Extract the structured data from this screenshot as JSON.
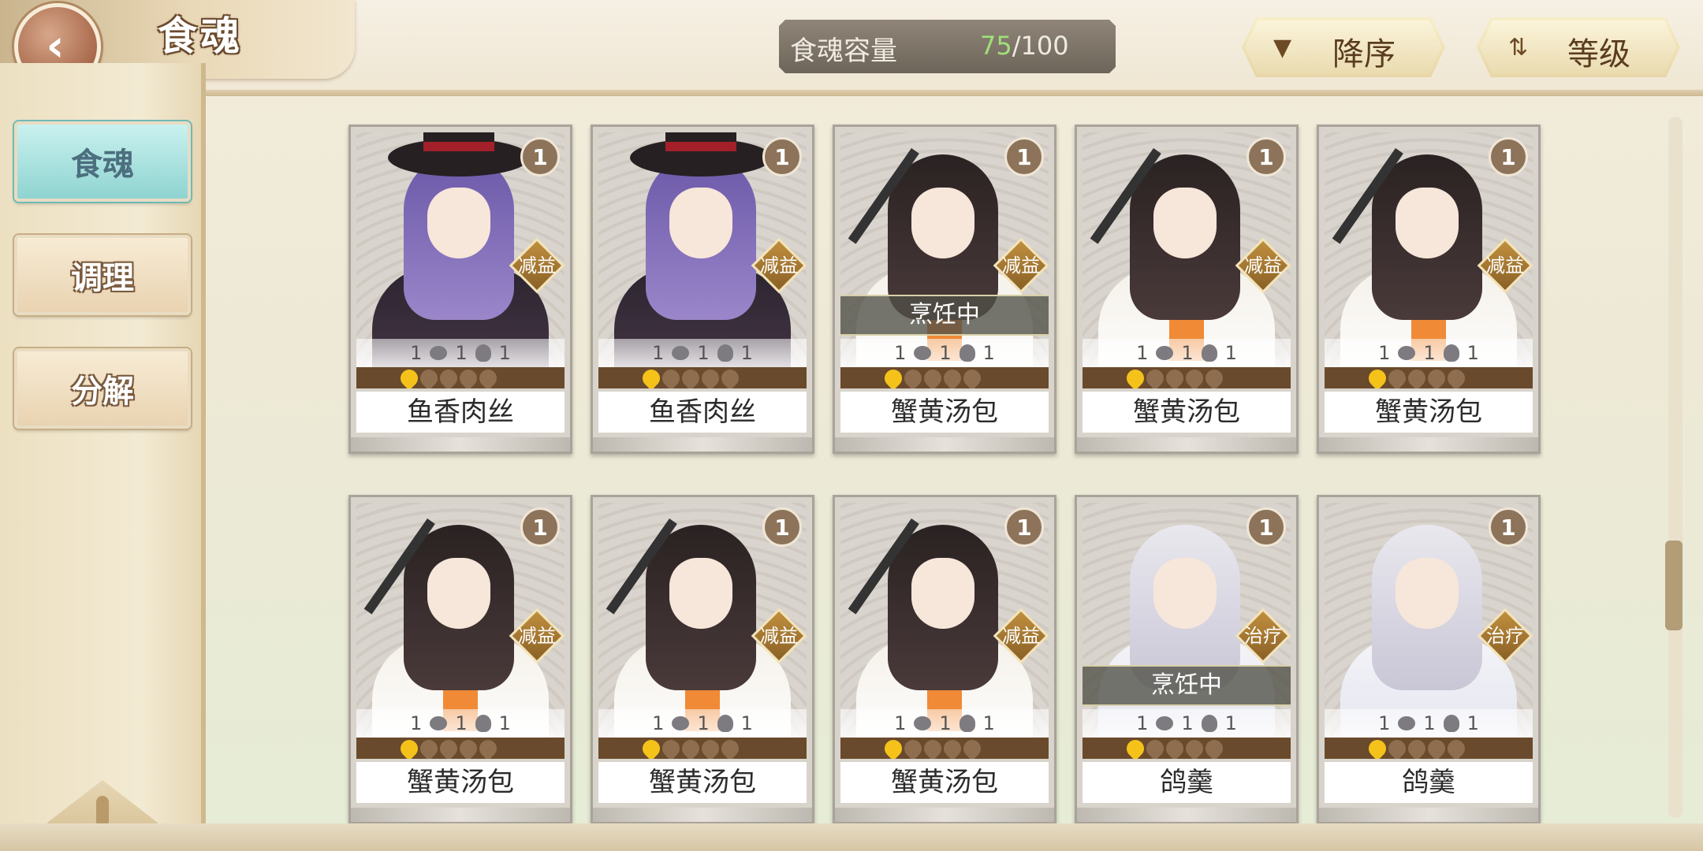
{
  "header": {
    "title": "食魂",
    "capacity": {
      "label": "食魂容量",
      "current": "75",
      "separator": "/",
      "max": "100"
    },
    "sort_order": {
      "label": "降序",
      "icon": "triangle-down-icon"
    },
    "sort_level": {
      "label": "等级",
      "icon": "sort-arrows-icon"
    }
  },
  "sidebar": {
    "items": [
      {
        "label": "食魂",
        "active": true
      },
      {
        "label": "调理",
        "active": false
      },
      {
        "label": "分解",
        "active": false
      }
    ]
  },
  "cards": [
    {
      "name": "鱼香肉丝",
      "level": "1",
      "role": "减益",
      "status": "",
      "stats": [
        "1",
        "1",
        "1"
      ],
      "stars": 1
    },
    {
      "name": "鱼香肉丝",
      "level": "1",
      "role": "减益",
      "status": "",
      "stats": [
        "1",
        "1",
        "1"
      ],
      "stars": 1
    },
    {
      "name": "蟹黄汤包",
      "level": "1",
      "role": "减益",
      "status": "烹饪中",
      "stats": [
        "1",
        "1",
        "1"
      ],
      "stars": 1
    },
    {
      "name": "蟹黄汤包",
      "level": "1",
      "role": "减益",
      "status": "",
      "stats": [
        "1",
        "1",
        "1"
      ],
      "stars": 1
    },
    {
      "name": "蟹黄汤包",
      "level": "1",
      "role": "减益",
      "status": "",
      "stats": [
        "1",
        "1",
        "1"
      ],
      "stars": 1
    },
    {
      "name": "蟹黄汤包",
      "level": "1",
      "role": "减益",
      "status": "",
      "stats": [
        "1",
        "1",
        "1"
      ],
      "stars": 1
    },
    {
      "name": "蟹黄汤包",
      "level": "1",
      "role": "减益",
      "status": "",
      "stats": [
        "1",
        "1",
        "1"
      ],
      "stars": 1
    },
    {
      "name": "蟹黄汤包",
      "level": "1",
      "role": "减益",
      "status": "",
      "stats": [
        "1",
        "1",
        "1"
      ],
      "stars": 1
    },
    {
      "name": "鸽羹",
      "level": "1",
      "role": "治疗",
      "status": "烹饪中",
      "stats": [
        "1",
        "1",
        "1"
      ],
      "stars": 1
    },
    {
      "name": "鸽羹",
      "level": "1",
      "role": "治疗",
      "status": "",
      "stats": [
        "1",
        "1",
        "1"
      ],
      "stars": 1
    }
  ],
  "card_styles": [
    "purple",
    "purple",
    "orange",
    "orange",
    "orange",
    "orange",
    "orange",
    "orange",
    "silver",
    "silver"
  ],
  "colors": {
    "capacity_current": "#9fe07a",
    "star_on": "#f5c21a",
    "active_tab": "#8fd4d1"
  }
}
